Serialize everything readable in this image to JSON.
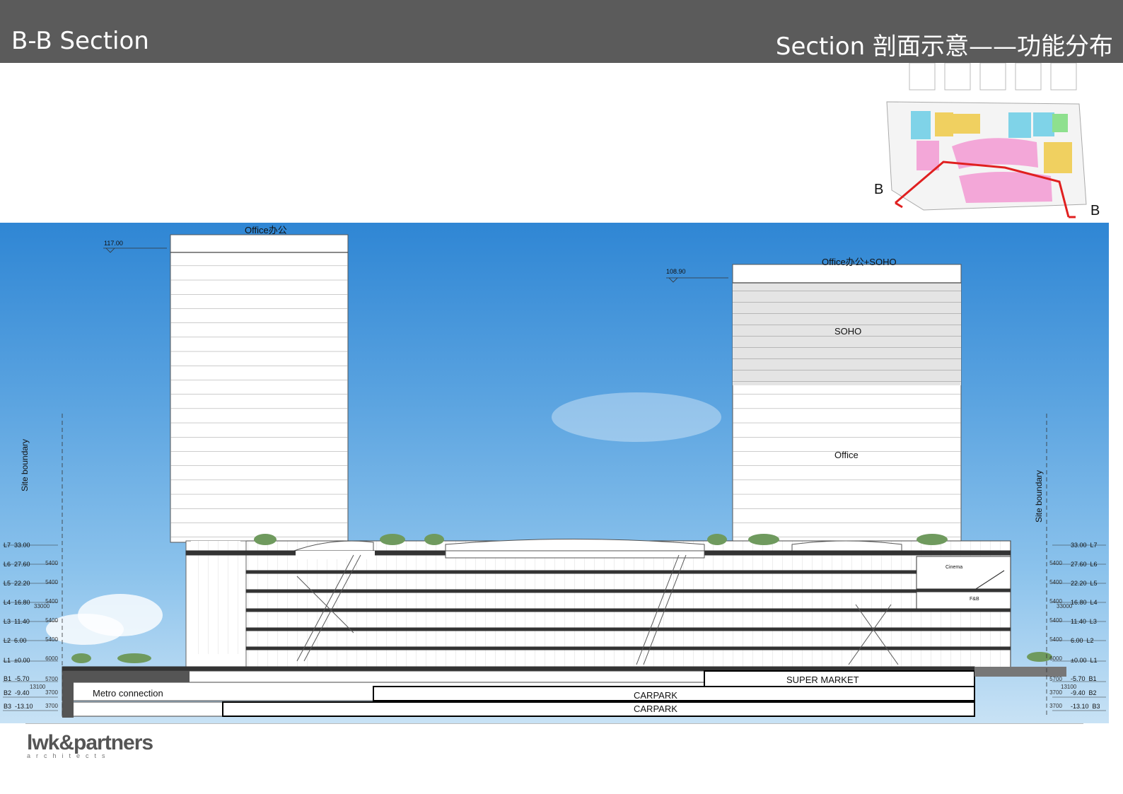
{
  "header": {
    "title_left": "B-B Section",
    "title_right": "Section 剖面示意——功能分布"
  },
  "keymap": {
    "section_mark": "B"
  },
  "section": {
    "tower1": {
      "label": "Office办公",
      "height_level": "117.00"
    },
    "tower2": {
      "label": "Office办公+SOHO",
      "height_level": "108.90",
      "soho_label": "SOHO",
      "office_label": "Office"
    },
    "site_boundary": "Site boundary",
    "left_levels": [
      {
        "name": "L7",
        "level": "33.00"
      },
      {
        "name": "L6",
        "level": "27.60"
      },
      {
        "name": "L5",
        "level": "22.20"
      },
      {
        "name": "L4",
        "level": "16.80"
      },
      {
        "name": "L3",
        "level": "11.40"
      },
      {
        "name": "L2",
        "level": "6.00"
      },
      {
        "name": "L1",
        "level": "±0.00"
      },
      {
        "name": "B1",
        "level": "-5.70"
      },
      {
        "name": "B2",
        "level": "-9.40"
      },
      {
        "name": "B3",
        "level": "-13.10"
      }
    ],
    "right_levels": [
      {
        "name": "L7",
        "level": "33.00"
      },
      {
        "name": "L6",
        "level": "27.60"
      },
      {
        "name": "L5",
        "level": "22.20"
      },
      {
        "name": "L4",
        "level": "16.80"
      },
      {
        "name": "L3",
        "level": "11.40"
      },
      {
        "name": "L2",
        "level": "6.00"
      },
      {
        "name": "L1",
        "level": "±0.00"
      },
      {
        "name": "B1",
        "level": "-5.70"
      },
      {
        "name": "B2",
        "level": "-9.40"
      },
      {
        "name": "B3",
        "level": "-13.10"
      }
    ],
    "floor_dims": [
      "5400",
      "5400",
      "5400",
      "5400",
      "5400",
      "6000"
    ],
    "total_above": "33000",
    "basement_dims": [
      "5700",
      "3700",
      "3700"
    ],
    "total_below": "13100",
    "labels": {
      "metro": "Metro connection",
      "supermarket": "SUPER MARKET",
      "carpark1": "CARPARK",
      "carpark2": "CARPARK",
      "cinema": "Cinema",
      "fnb": "F&B"
    }
  },
  "footer": {
    "logo_name": "lwk&partners",
    "logo_sub": "architects"
  }
}
